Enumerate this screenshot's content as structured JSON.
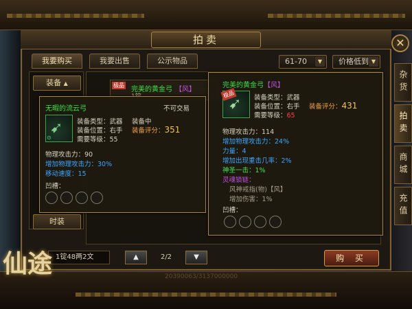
{
  "window": {
    "title": "拍卖",
    "close_glyph": "✕"
  },
  "tabs": [
    {
      "label": "我要购买",
      "active": true
    },
    {
      "label": "我要出售",
      "active": false
    },
    {
      "label": "公示物品",
      "active": false
    }
  ],
  "filters": {
    "level_range": "61-70",
    "sort": "价格低到高"
  },
  "side_tabs": [
    "杂货",
    "拍卖",
    "商城",
    "充值"
  ],
  "left_menu": {
    "category": "装备",
    "category_arrow": "▲",
    "fashion": "时装"
  },
  "list": {
    "row_badge": "极品",
    "row_name": "完美的黄金弓",
    "row_tag": "【风】",
    "row_sub": "1锭"
  },
  "tooltip_left": {
    "name": "无暇的流云弓",
    "trade": "不可交易",
    "fields": {
      "type": "装备类型：武器",
      "slot": "装备位置：右手",
      "level": "需要等级：",
      "level_value": "55",
      "state": "装备中",
      "score": "装备评分：",
      "score_value": "351"
    },
    "stats": [
      {
        "text": "物理攻击力：90",
        "class": ""
      },
      {
        "text": "增加物理攻击力：30%",
        "class": "t-blue"
      },
      {
        "text": "移动速度：15",
        "class": "t-blue"
      }
    ],
    "sockets_label": "凹槽："
  },
  "tooltip_right": {
    "name": "完美的黄金弓",
    "tag": "【风】",
    "badge": "极品",
    "fields": {
      "type": "装备类型：武器",
      "slot": "装备位置：右手",
      "level": "需要等级：",
      "level_value": "65",
      "score": "装备评分：",
      "score_value": "431"
    },
    "stats": [
      {
        "text": "物理攻击力：114",
        "class": ""
      },
      {
        "text": "增加物理攻击力：24%",
        "class": "t-blue"
      },
      {
        "text": "力量：4",
        "class": "t-blue"
      },
      {
        "text": "增加出现重击几率：2%",
        "class": "t-blue"
      },
      {
        "text": "神圣一击：1%",
        "class": "t-green"
      },
      {
        "text": "灵魂锁链：",
        "class": "t-purple"
      },
      {
        "text": "风神戒指(物)【风】",
        "class": "t-gray"
      },
      {
        "text": "增加伤害：1%",
        "class": "t-gray"
      }
    ],
    "sockets_label": "凹槽："
  },
  "footer": {
    "money": "1锭48两2文",
    "page": "2/2",
    "prev_glyph": "▲",
    "next_glyph": "▼",
    "buy_label": "购 买",
    "game_logo": "仙途",
    "bottom_number": "20390063/3137000000"
  }
}
